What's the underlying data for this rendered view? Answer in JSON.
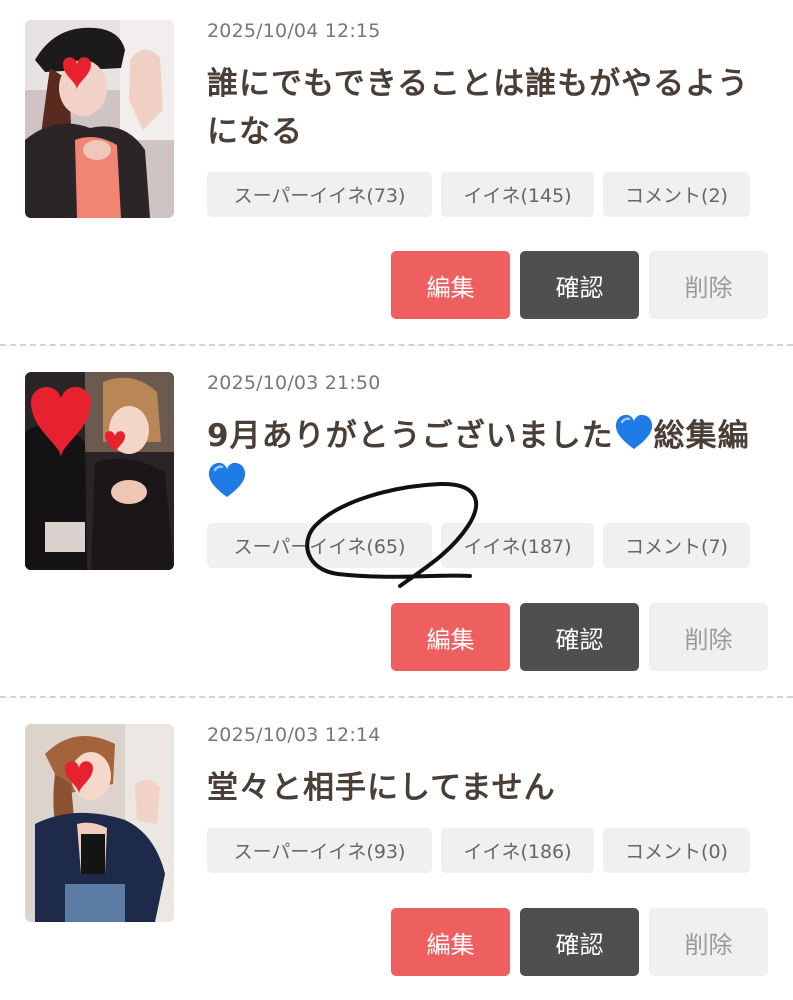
{
  "posts": [
    {
      "date": "2025/10/04 12:15",
      "title": "誰にでもできることは誰もがやるようになる",
      "stats": {
        "super_like": "スーパーイイネ(73)",
        "like": "イイネ(145)",
        "comment": "コメント(2)"
      },
      "buttons": {
        "edit": "編集",
        "confirm": "確認",
        "delete": "削除"
      }
    },
    {
      "date": "2025/10/03 21:50",
      "title_part1": "9月ありがとうございました",
      "title_part2": "総集編",
      "title_emoji": "blue-heart",
      "stats": {
        "super_like": "スーパーイイネ(65)",
        "like": "イイネ(187)",
        "comment": "コメント(7)"
      },
      "buttons": {
        "edit": "編集",
        "confirm": "確認",
        "delete": "削除"
      }
    },
    {
      "date": "2025/10/03 12:14",
      "title": "堂々と相手にしてません",
      "stats": {
        "super_like": "スーパーイイネ(93)",
        "like": "イイネ(186)",
        "comment": "コメント(0)"
      },
      "buttons": {
        "edit": "編集",
        "confirm": "確認",
        "delete": "削除"
      }
    }
  ],
  "colors": {
    "edit_button": "#ee6060",
    "confirm_button": "#4f4f4f",
    "delete_button": "#f0f0f0",
    "title_text": "#4a3f37",
    "heart_red": "#e8212e",
    "heart_blue": "#1e7be6"
  }
}
